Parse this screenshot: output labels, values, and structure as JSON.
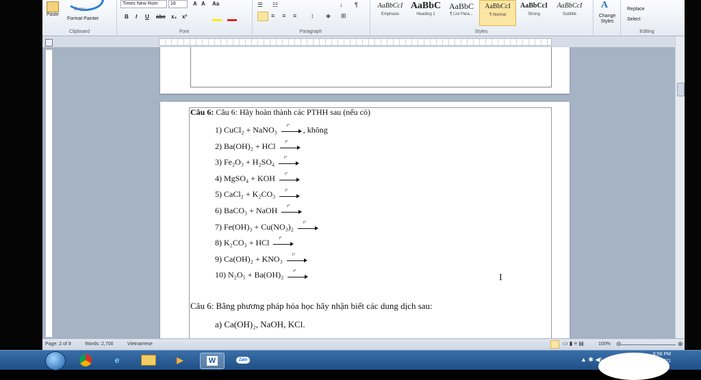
{
  "ribbon": {
    "clipboard": {
      "paste": "Paste",
      "copy": "Copy",
      "format_painter": "Format Painter",
      "label": "Clipboard"
    },
    "font": {
      "name": "Times New Rom",
      "size": "16",
      "label": "Font",
      "bold": "B",
      "italic": "I",
      "underline": "U"
    },
    "paragraph": {
      "label": "Paragraph"
    },
    "styles": {
      "label": "Styles",
      "items": [
        {
          "preview": "AaBbCcI",
          "name": "Emphasis"
        },
        {
          "preview": "AaBbC",
          "name": "Heading 1"
        },
        {
          "preview": "AaBbC",
          "name": "¶ List Para..."
        },
        {
          "preview": "AaBbCcI",
          "name": "¶ Normal"
        },
        {
          "preview": "AaBbCcI",
          "name": "Strong"
        },
        {
          "preview": "AaBbCcI",
          "name": "Subtitle"
        }
      ],
      "change_styles": "Change Styles"
    },
    "editing": {
      "replace": "Replace",
      "select": "Select",
      "label": "Editing"
    }
  },
  "document": {
    "question1": "Câu 6: Hãy hoàn thành các PTHH sau (nếu có)",
    "equations": [
      {
        "text": "1)  CuCl₂  +  NaNO₃",
        "tail": ", không",
        "cond": "t°"
      },
      {
        "text": "2)  Ba(OH)₂  +  HCl",
        "tail": "",
        "cond": "t°"
      },
      {
        "text": "3)  Fe₂O₃  +  H₂SO₄",
        "tail": "",
        "cond": "t°"
      },
      {
        "text": "4)  MgSO₄  +  KOH",
        "tail": "",
        "cond": "t°"
      },
      {
        "text": "5)  CaCl₂  +  K₂CO₃",
        "tail": "",
        "cond": "t°"
      },
      {
        "text": "6)  BaCO₃  +  NaOH",
        "tail": "",
        "cond": "t°"
      },
      {
        "text": "7)  Fe(OH)₃  +  Cu(NO₃)₂",
        "tail": "",
        "cond": "t°"
      },
      {
        "text": "8)  K₂CO₃  +  HCl",
        "tail": "",
        "cond": "t°"
      },
      {
        "text": "9)  Ca(OH)₂  +  KNO₃",
        "tail": "",
        "cond": "t°"
      },
      {
        "text": "10)   N₂O₅ +  Ba(OH)₂",
        "tail": "",
        "cond": "t°"
      }
    ],
    "question2": "Câu 6: Bằng  phương pháp hóa học hãy nhận biết các dung dịch sau:",
    "item_a": "a)  Ca(OH)₂, NaOH, KCl."
  },
  "status": {
    "page": "Page: 2 of 9",
    "words": "Words: 2,700",
    "language": "Vietnamese",
    "zoom": "100%"
  },
  "taskbar": {
    "word": "W",
    "zalo": "Zalo",
    "time": "6:58 PM",
    "date": "2021"
  }
}
